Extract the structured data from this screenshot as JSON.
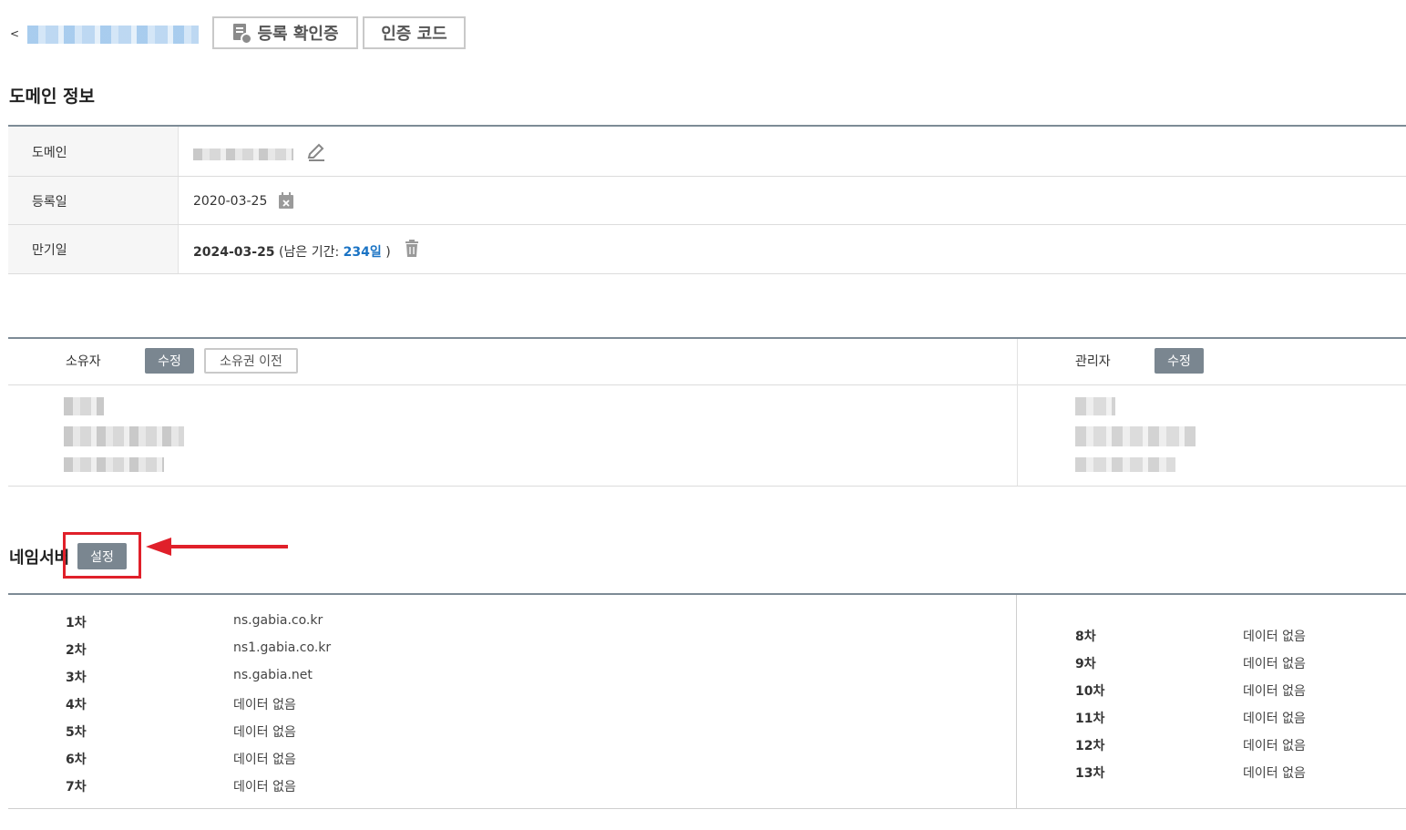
{
  "topbar": {
    "back_label": "<",
    "cert_button": "등록 확인증",
    "auth_code_button": "인증 코드"
  },
  "domain_info": {
    "title": "도메인 정보",
    "rows": [
      {
        "label": "도메인",
        "value": ""
      },
      {
        "label": "등록일",
        "value": "2020-03-25"
      },
      {
        "label": "만기일",
        "value": "2024-03-25"
      }
    ],
    "remaining_prefix": "(남은 기간:",
    "remaining_days": "234일",
    "remaining_suffix": ")"
  },
  "contacts": {
    "owner_label": "소유자",
    "owner_edit": "수정",
    "owner_transfer": "소유권 이전",
    "admin_label": "관리자",
    "admin_edit": "수정"
  },
  "nameserver": {
    "title": "네임서버",
    "setting_button": "설정",
    "left": [
      {
        "num": "1차",
        "value": "ns.gabia.co.kr"
      },
      {
        "num": "2차",
        "value": "ns1.gabia.co.kr"
      },
      {
        "num": "3차",
        "value": "ns.gabia.net"
      },
      {
        "num": "4차",
        "value": "데이터 없음"
      },
      {
        "num": "5차",
        "value": "데이터 없음"
      },
      {
        "num": "6차",
        "value": "데이터 없음"
      },
      {
        "num": "7차",
        "value": "데이터 없음"
      }
    ],
    "right": [
      {
        "num": "8차",
        "value": "데이터 없음"
      },
      {
        "num": "9차",
        "value": "데이터 없음"
      },
      {
        "num": "10차",
        "value": "데이터 없음"
      },
      {
        "num": "11차",
        "value": "데이터 없음"
      },
      {
        "num": "12차",
        "value": "데이터 없음"
      },
      {
        "num": "13차",
        "value": "데이터 없음"
      }
    ]
  },
  "colors": {
    "accent_blue": "#1a73c4",
    "button_dark": "#7a8690",
    "highlight_red": "#e0202a"
  }
}
